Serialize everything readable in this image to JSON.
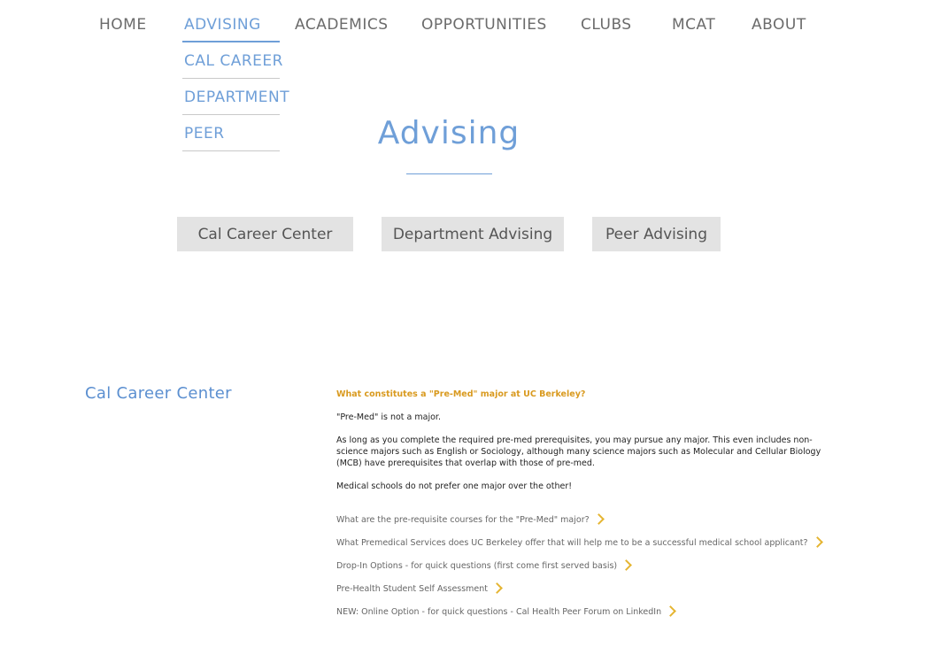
{
  "nav": {
    "items": [
      {
        "label": "HOME",
        "active": false
      },
      {
        "label": "ADVISING",
        "active": true
      },
      {
        "label": "ACADEMICS",
        "active": false
      },
      {
        "label": "OPPORTUNITIES",
        "active": false
      },
      {
        "label": "CLUBS",
        "active": false
      },
      {
        "label": "MCAT",
        "active": false
      },
      {
        "label": "ABOUT",
        "active": false
      }
    ],
    "dropdown": [
      "CAL CAREER",
      "DEPARTMENT",
      "PEER"
    ]
  },
  "page_title": "Advising",
  "buttons": [
    "Cal Career Center",
    "Department Advising",
    "Peer Advising"
  ],
  "section": {
    "title": "Cal Career Center",
    "question": "What constitutes a \"Pre-Med\" major at UC Berkeley?",
    "paragraphs": [
      "\"Pre-Med\" is not a major.",
      "As long as you complete the required pre-med prerequisites, you may pursue any major. This even includes non-science majors such as English or Sociology, although many science majors such as Molecular and Cellular Biology (MCB) have prerequisites that overlap with those of pre-med.",
      "Medical schools do not prefer one major over the other!"
    ],
    "links": [
      "What are the pre-requisite courses for the \"Pre-Med\" major?",
      "What Premedical Services does UC Berkeley offer that will help me to be a successful medical school applicant?",
      "Drop-In Options - for quick questions (first come first served basis)",
      "Pre-Health Student Self Assessment",
      "NEW: Online Option - for quick questions - Cal Health Peer Forum on LinkedIn"
    ]
  },
  "colors": {
    "accent_blue": "#6f9fd8",
    "accent_gold": "#d99a1f",
    "chevron": "#e5b532",
    "button_bg": "#e3e3e3"
  }
}
